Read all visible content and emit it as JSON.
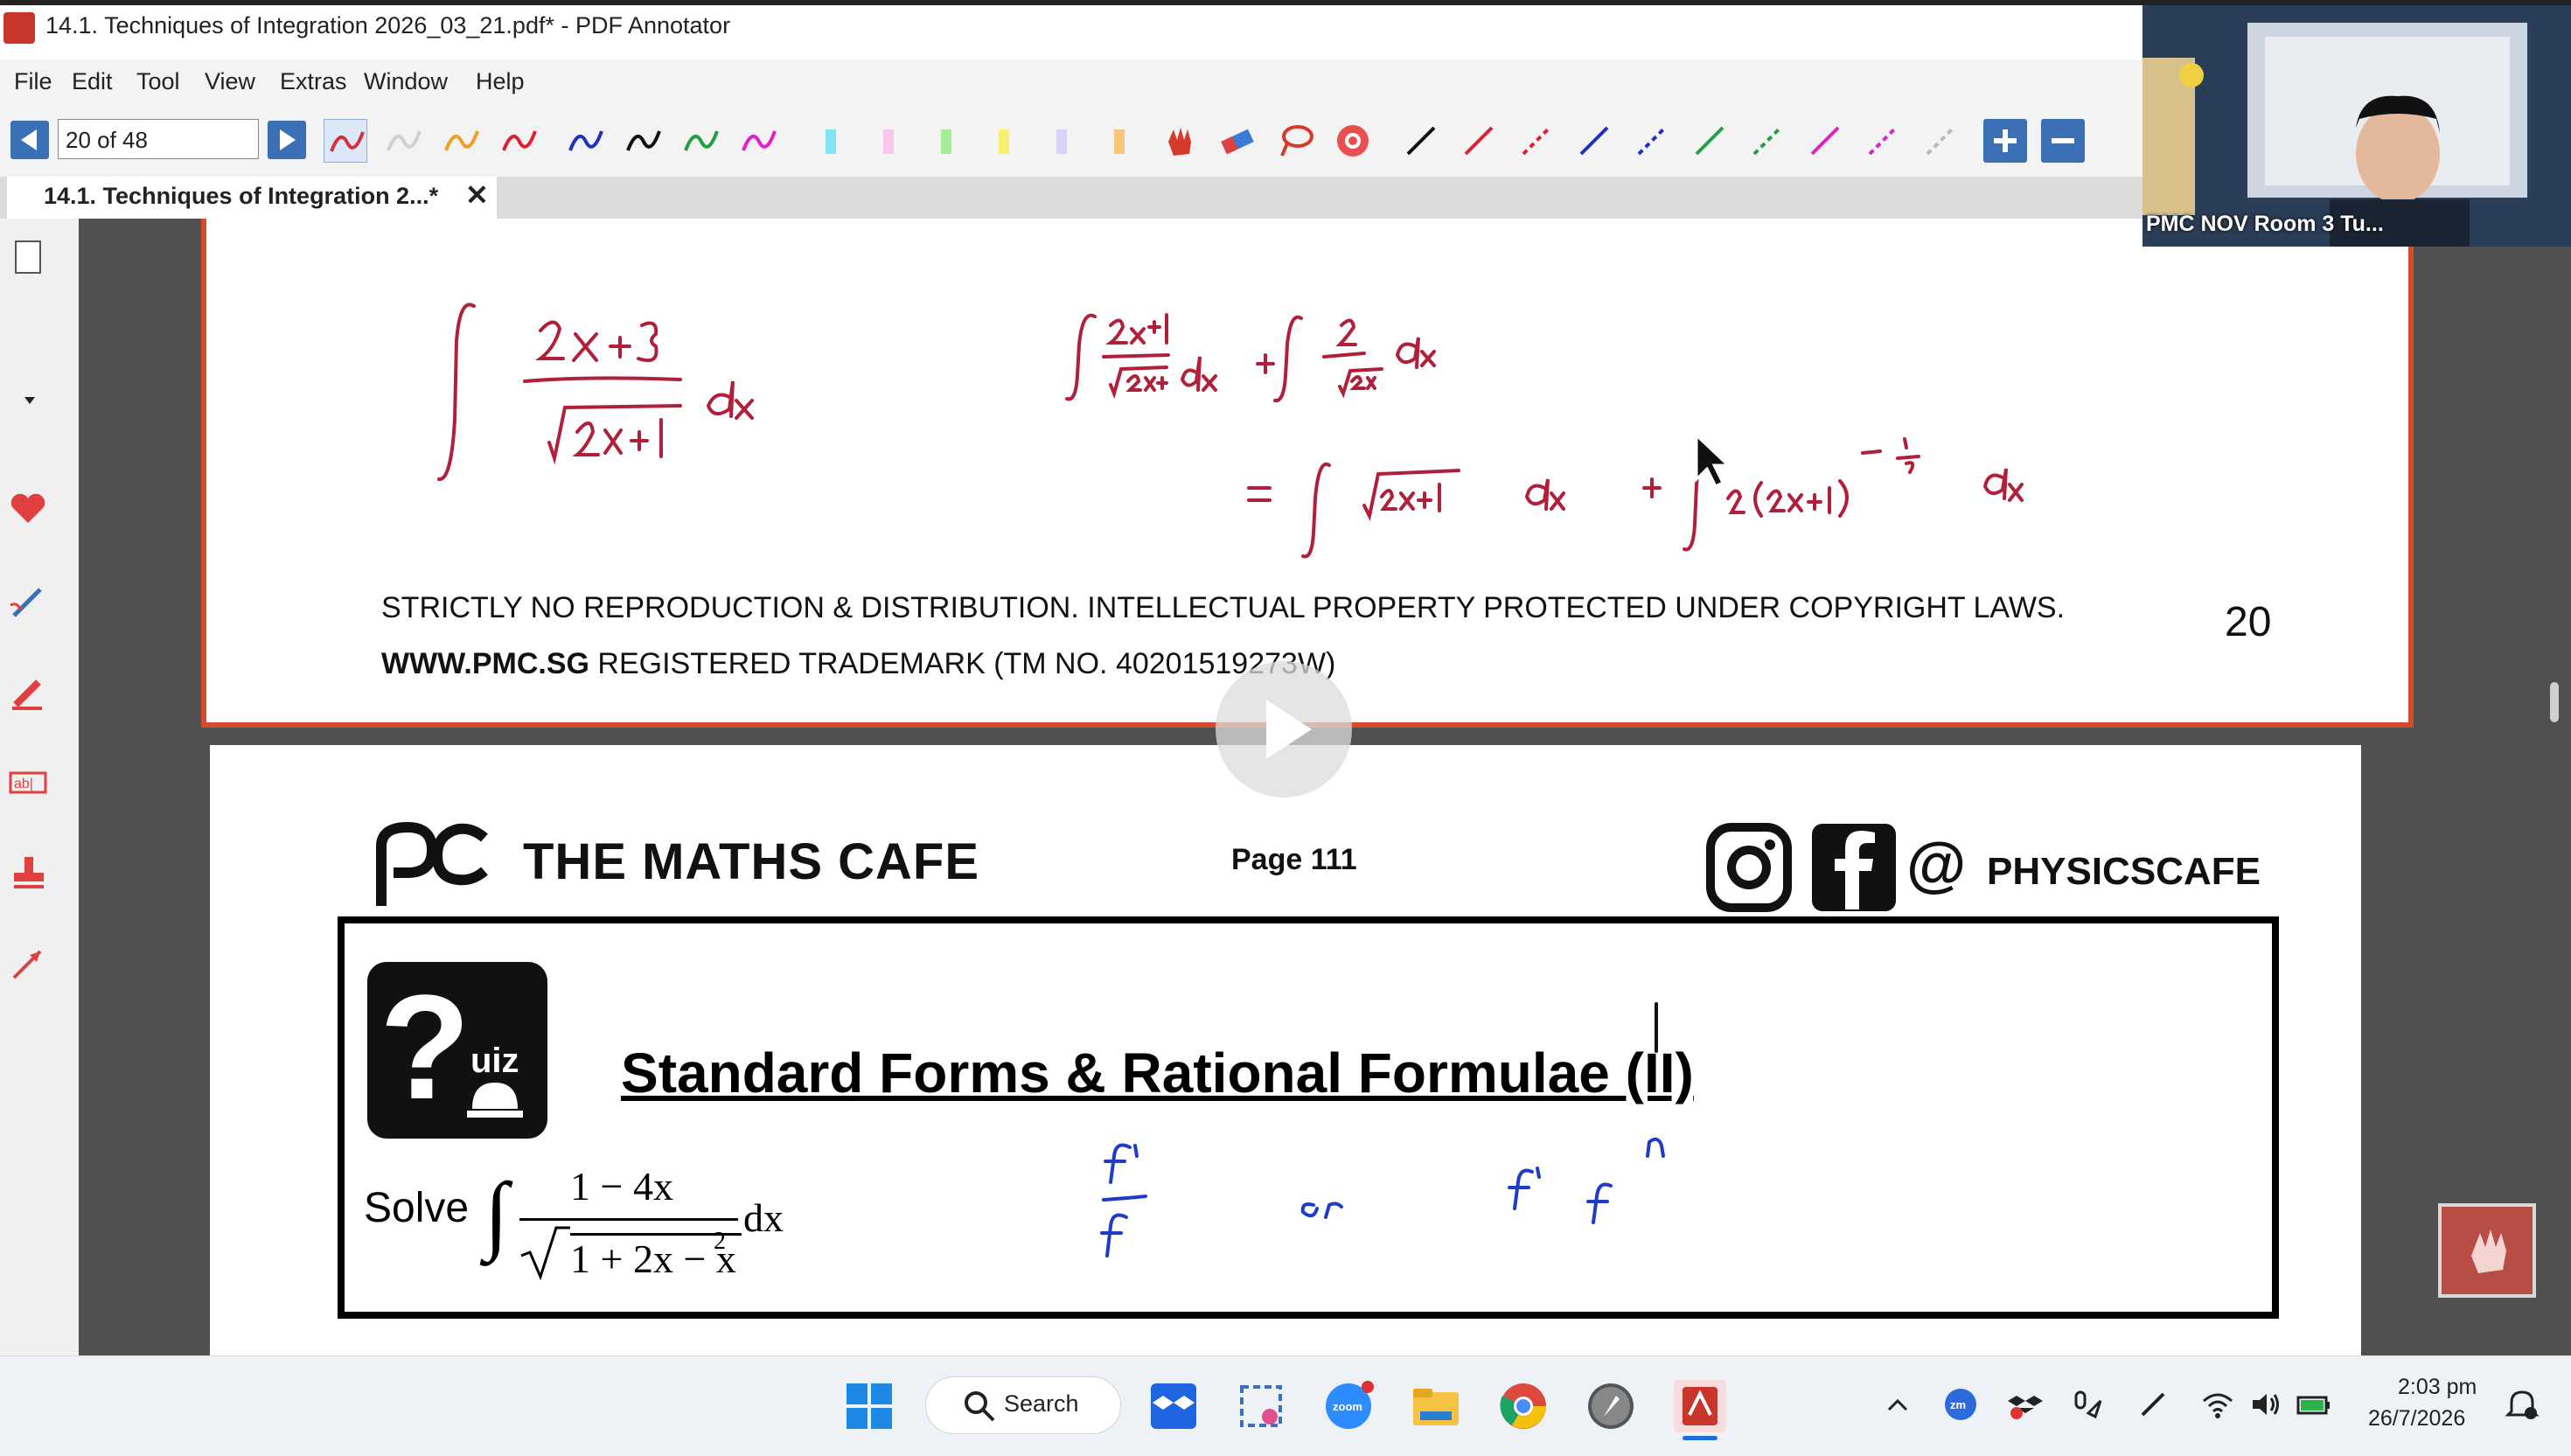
{
  "window": {
    "title": "14.1. Techniques of Integration 2026_03_21.pdf* - PDF Annotator"
  },
  "menu": [
    "File",
    "Edit",
    "Tool",
    "View",
    "Extras",
    "Window",
    "Help"
  ],
  "toolbar": {
    "page_indicator": "20 of 48"
  },
  "tab": {
    "label": "14.1. Techniques of Integration 2...*",
    "close": "✕"
  },
  "page1": {
    "copyright_line1": "STRICTLY NO REPRODUCTION & DISTRIBUTION. INTELLECTUAL PROPERTY PROTECTED UNDER COPYRIGHT LAWS.",
    "copyright_site": "WWW.PMC.SG",
    "copyright_line2_rest": " REGISTERED TRADEMARK (TM NO. 40201519273W)",
    "page_number": "20"
  },
  "page2": {
    "brand": "THE MATHS CAFE",
    "page_label": "Page 111",
    "handle": "PHYSICSCAFE",
    "at": "@",
    "quiz_word": "uiz",
    "quiz_title": "Standard Forms & Rational Formulae (II)",
    "solve_label": "Solve",
    "numerator": "1 − 4x",
    "denominator": "1 + 2x − x",
    "exponent": "2",
    "dx": "dx"
  },
  "webcam": {
    "label": "PMC NOV Room 3 Tu..."
  },
  "taskbar": {
    "search": "Search",
    "time": "2:03 pm",
    "date": "26/7/2026"
  },
  "colors": {
    "accent_blue": "#3b6fb6",
    "page_border": "#d64b2d",
    "ink_red": "#b0203a",
    "ink_blue": "#1f3cc9"
  }
}
